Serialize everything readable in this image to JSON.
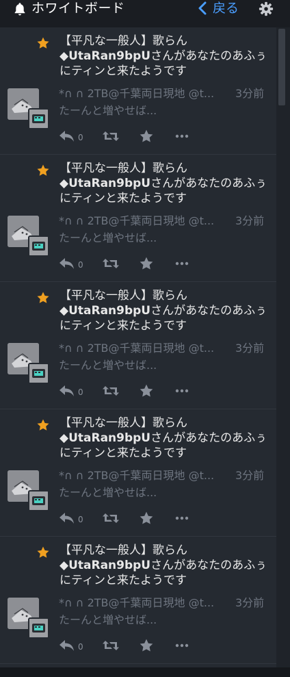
{
  "header": {
    "title": "ホワイトボード",
    "back_label": "戻る"
  },
  "notifications": [
    {
      "headline_prefix": "【平凡な一般人】歌らん",
      "user_handle": "◆UtaRan9bpU",
      "headline_suffix": "さんがあなたのあふぅにティンと来たようです",
      "author": "*∩ ∩ 2TB@千葉両日現地 @t...",
      "time": "3分前",
      "body": "たーんと増やせば...",
      "reply_count": "0"
    },
    {
      "headline_prefix": "【平凡な一般人】歌らん",
      "user_handle": "◆UtaRan9bpU",
      "headline_suffix": "さんがあなたのあふぅにティンと来たようです",
      "author": "*∩ ∩ 2TB@千葉両日現地 @t...",
      "time": "3分前",
      "body": "たーんと増やせば...",
      "reply_count": "0"
    },
    {
      "headline_prefix": "【平凡な一般人】歌らん",
      "user_handle": "◆UtaRan9bpU",
      "headline_suffix": "さんがあなたのあふぅにティンと来たようです",
      "author": "*∩ ∩ 2TB@千葉両日現地 @t...",
      "time": "3分前",
      "body": "たーんと増やせば...",
      "reply_count": "0"
    },
    {
      "headline_prefix": "【平凡な一般人】歌らん",
      "user_handle": "◆UtaRan9bpU",
      "headline_suffix": "さんがあなたのあふぅにティンと来たようです",
      "author": "*∩ ∩ 2TB@千葉両日現地 @t...",
      "time": "3分前",
      "body": "たーんと増やせば...",
      "reply_count": "0"
    },
    {
      "headline_prefix": "【平凡な一般人】歌らん",
      "user_handle": "◆UtaRan9bpU",
      "headline_suffix": "さんがあなたのあふぅにティンと来たようです",
      "author": "*∩ ∩ 2TB@千葉両日現地 @t...",
      "time": "3分前",
      "body": "たーんと増やせば...",
      "reply_count": "0"
    }
  ],
  "colors": {
    "accent": "#4a9eff",
    "star": "#f0a020",
    "background": "#252a31",
    "header_bg": "#1a1d22",
    "muted_text": "#6e7580"
  },
  "icons": {
    "header_left": "bell-icon",
    "back": "chevron-left-icon",
    "settings": "gear-icon",
    "favorite_marker": "star-icon",
    "reply": "reply-icon",
    "retweet": "retweet-icon",
    "like": "star-icon",
    "more": "more-icon"
  }
}
